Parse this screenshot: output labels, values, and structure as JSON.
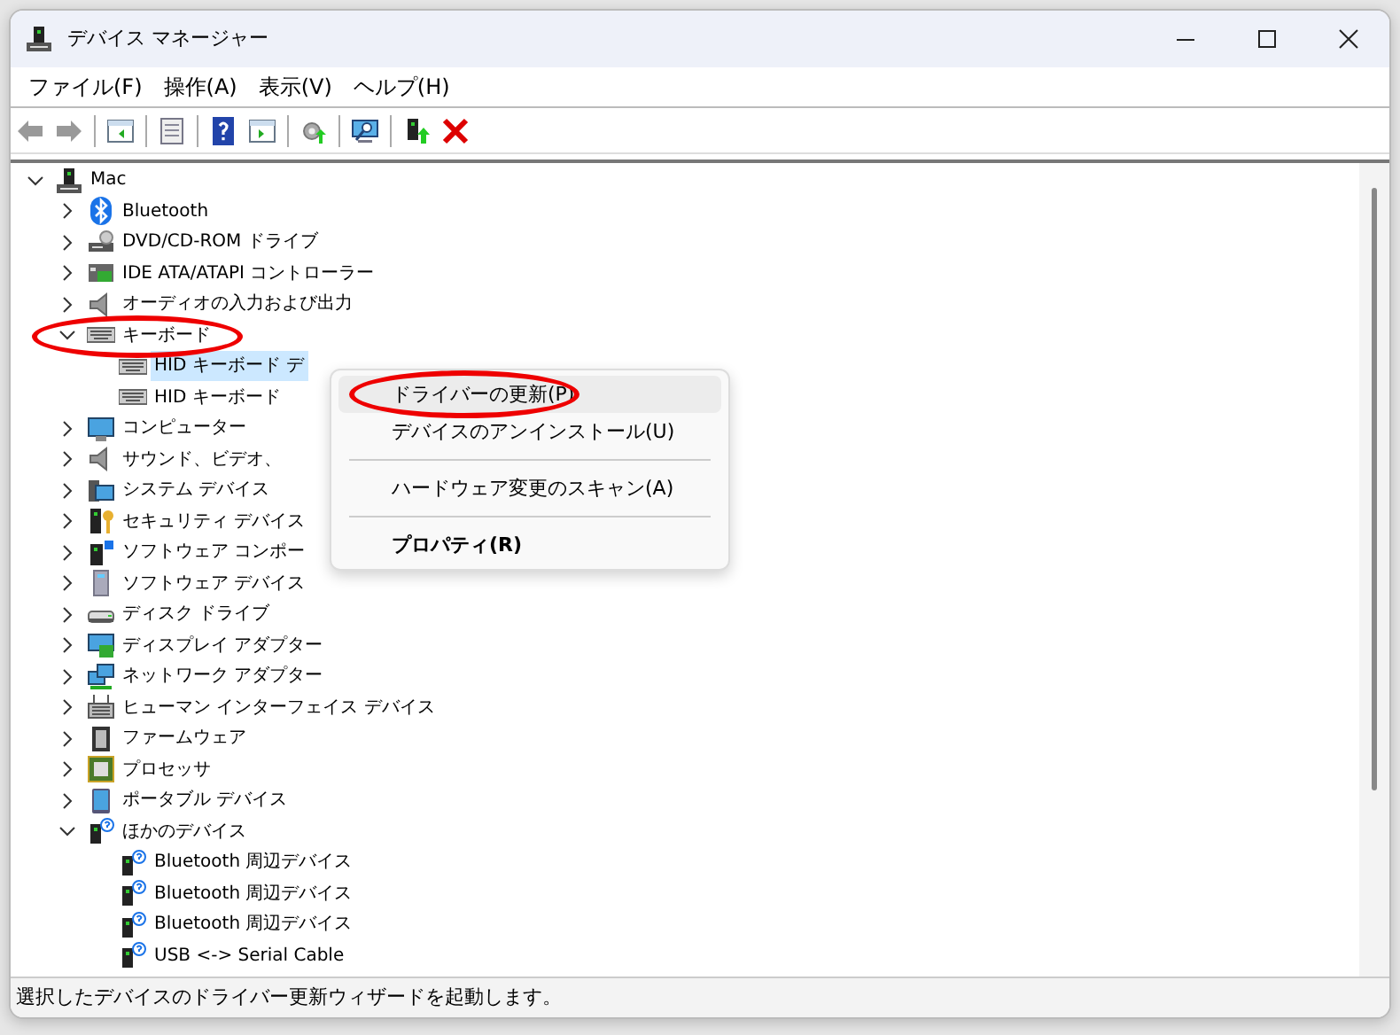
{
  "window": {
    "title": "デバイス マネージャー"
  },
  "menu_bar": [
    {
      "label": "ファイル(F)"
    },
    {
      "label": "操作(A)"
    },
    {
      "label": "表示(V)"
    },
    {
      "label": "ヘルプ(H)"
    }
  ],
  "tree": {
    "label": "Mac",
    "expanded": true,
    "selected": false,
    "children": [
      {
        "label": "Bluetooth",
        "expanded": false,
        "selected": false
      },
      {
        "label": "DVD/CD-ROM ドライブ",
        "expanded": false,
        "selected": false
      },
      {
        "label": "IDE ATA/ATAPI コントローラー",
        "expanded": false,
        "selected": false
      },
      {
        "label": "オーディオの入力および出力",
        "expanded": false,
        "selected": false
      },
      {
        "label": "キーボード",
        "expanded": true,
        "selected": false,
        "circled": true,
        "children": [
          {
            "label": "HID キーボード デ",
            "selected": true
          },
          {
            "label": "HID キーボード",
            "selected": false
          }
        ]
      },
      {
        "label": "コンピューター",
        "expanded": false,
        "selected": false
      },
      {
        "label": "サウンド、ビデオ、",
        "expanded": false,
        "selected": false
      },
      {
        "label": "システム デバイス",
        "expanded": false,
        "selected": false
      },
      {
        "label": "セキュリティ デバイス",
        "expanded": false,
        "selected": false
      },
      {
        "label": "ソフトウェア コンポー",
        "expanded": false,
        "selected": false
      },
      {
        "label": "ソフトウェア デバイス",
        "expanded": false,
        "selected": false
      },
      {
        "label": "ディスク ドライブ",
        "expanded": false,
        "selected": false
      },
      {
        "label": "ディスプレイ アダプター",
        "expanded": false,
        "selected": false
      },
      {
        "label": "ネットワーク アダプター",
        "expanded": false,
        "selected": false
      },
      {
        "label": "ヒューマン インターフェイス デバイス",
        "expanded": false,
        "selected": false
      },
      {
        "label": "ファームウェア",
        "expanded": false,
        "selected": false
      },
      {
        "label": "プロセッサ",
        "expanded": false,
        "selected": false
      },
      {
        "label": "ポータブル デバイス",
        "expanded": false,
        "selected": false
      },
      {
        "label": "ほかのデバイス",
        "expanded": true,
        "selected": false,
        "children": [
          {
            "label": "Bluetooth 周辺デバイス",
            "selected": false
          },
          {
            "label": "Bluetooth 周辺デバイス",
            "selected": false
          },
          {
            "label": "Bluetooth 周辺デバイス",
            "selected": false
          },
          {
            "label": "USB <-> Serial Cable",
            "selected": false
          }
        ]
      }
    ]
  },
  "context_menu": {
    "items": [
      {
        "kind": "item",
        "label": "ドライバーの更新(P)",
        "selected": true,
        "circled": true
      },
      {
        "kind": "item",
        "label": "デバイスのアンインストール(U)",
        "selected": false
      },
      {
        "kind": "separator"
      },
      {
        "kind": "item",
        "label": "ハードウェア変更のスキャン(A)",
        "selected": false
      },
      {
        "kind": "separator"
      },
      {
        "kind": "item",
        "label": "プロパティ(R)",
        "selected": false,
        "bold": true
      }
    ]
  },
  "status_bar": "選択したデバイスのドライバー更新ウィザードを起動します。"
}
